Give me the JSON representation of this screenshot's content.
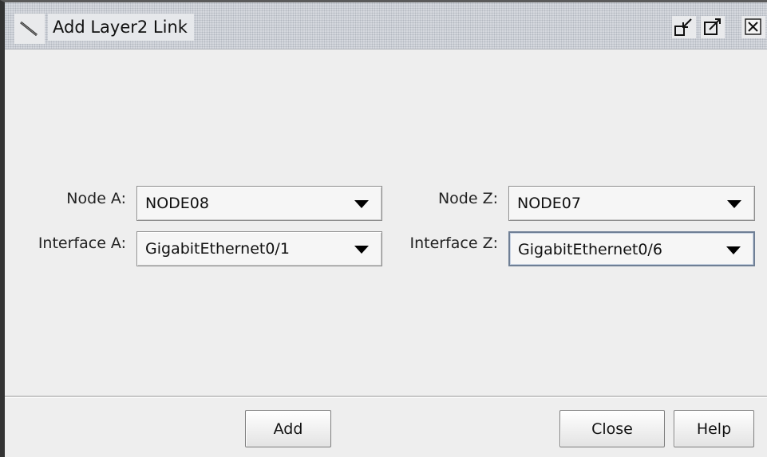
{
  "dialog": {
    "title": "Add Layer2 Link",
    "icon": "link-tool-icon",
    "title_buttons": [
      "minimize-icon",
      "maximize-icon",
      "close-icon"
    ]
  },
  "form": {
    "node_a_label": "Node A:",
    "node_a_value": "NODE08",
    "interface_a_label": "Interface A:",
    "interface_a_value": "GigabitEthernet0/1",
    "node_z_label": "Node Z:",
    "node_z_value": "NODE07",
    "interface_z_label": "Interface Z:",
    "interface_z_value": "GigabitEthernet0/6"
  },
  "buttons": {
    "add": "Add",
    "close": "Close",
    "help": "Help"
  }
}
